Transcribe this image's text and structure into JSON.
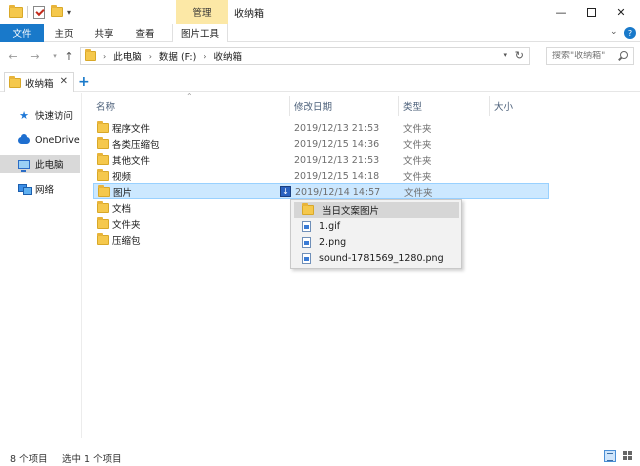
{
  "window": {
    "title": "收纳箱",
    "context_tab": "管理"
  },
  "ribbon": {
    "tabs": [
      {
        "label": "文件"
      },
      {
        "label": "主页"
      },
      {
        "label": "共享"
      },
      {
        "label": "查看"
      },
      {
        "label": "图片工具"
      }
    ]
  },
  "address": {
    "breadcrumbs": [
      "此电脑",
      "数据 (F:)",
      "收纳箱"
    ],
    "search_placeholder": "搜索\"收纳箱\""
  },
  "tab_strip": {
    "tabs": [
      {
        "label": "收纳箱"
      }
    ],
    "add_label": "+"
  },
  "nav_pane": {
    "items": [
      {
        "label": "快速访问",
        "icon": "star-icon"
      },
      {
        "label": "OneDrive",
        "icon": "cloud-icon"
      },
      {
        "label": "此电脑",
        "icon": "pc-icon",
        "selected": true
      },
      {
        "label": "网络",
        "icon": "network-icon"
      }
    ]
  },
  "file_list": {
    "columns": [
      "名称",
      "修改日期",
      "类型",
      "大小"
    ],
    "rows": [
      {
        "name": "程序文件",
        "date": "2019/12/13 21:53",
        "type": "文件夹"
      },
      {
        "name": "各类压缩包",
        "date": "2019/12/15 14:36",
        "type": "文件夹"
      },
      {
        "name": "其他文件",
        "date": "2019/12/13 21:53",
        "type": "文件夹"
      },
      {
        "name": "视频",
        "date": "2019/12/15 14:18",
        "type": "文件夹"
      },
      {
        "name": "图片",
        "date": "2019/12/14 14:57",
        "type": "文件夹",
        "selected": true
      },
      {
        "name": "文档",
        "date": "",
        "type": ""
      },
      {
        "name": "文件夹",
        "date": "",
        "type": ""
      },
      {
        "name": "压缩包",
        "date": "",
        "type": ""
      }
    ]
  },
  "popup": {
    "items": [
      {
        "label": "当日文案图片",
        "icon": "folder-icon"
      },
      {
        "label": "1.gif",
        "icon": "image-file-icon"
      },
      {
        "label": "2.png",
        "icon": "image-file-icon"
      },
      {
        "label": "sound-1781569_1280.png",
        "icon": "image-file-icon"
      }
    ]
  },
  "status": {
    "item_count": "8 个项目",
    "selection": "选中 1 个项目"
  },
  "colors": {
    "accent": "#1979ca",
    "manage_tab": "#fce8a6",
    "selection_bg": "#cce8ff",
    "folder": "#f5c84c"
  }
}
